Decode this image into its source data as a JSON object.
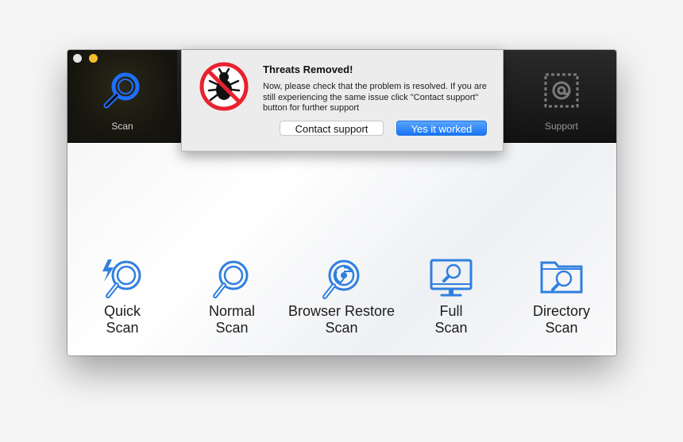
{
  "window": {
    "controls": [
      "close",
      "minimize"
    ]
  },
  "toolbar": {
    "items": [
      {
        "label": "Scan",
        "icon": "magnifier-icon",
        "active": true
      },
      {
        "label": "Support",
        "icon": "at-stamp-icon",
        "active": false
      }
    ]
  },
  "alert": {
    "icon": "no-bug-icon",
    "title": "Threats Removed!",
    "message": "Now, please check that the problem is resolved. If you are still experiencing the same issue click \"Contact support\" button for further support",
    "secondary_button": "Contact support",
    "primary_button": "Yes it worked"
  },
  "scan_options": [
    {
      "line1": "Quick",
      "line2": "Scan",
      "icon": "quick-scan-icon"
    },
    {
      "line1": "Normal",
      "line2": "Scan",
      "icon": "normal-scan-icon"
    },
    {
      "line1": "Browser Restore",
      "line2": "Scan",
      "icon": "browser-scan-icon"
    },
    {
      "line1": "Full",
      "line2": "Scan",
      "icon": "full-scan-icon"
    },
    {
      "line1": "Directory",
      "line2": "Scan",
      "icon": "directory-scan-icon"
    }
  ],
  "colors": {
    "accent": "#2f7fe0",
    "toolbar_icon": "#1f6fff",
    "primary_button": "#1775f6",
    "bug_red": "#e8222e"
  }
}
